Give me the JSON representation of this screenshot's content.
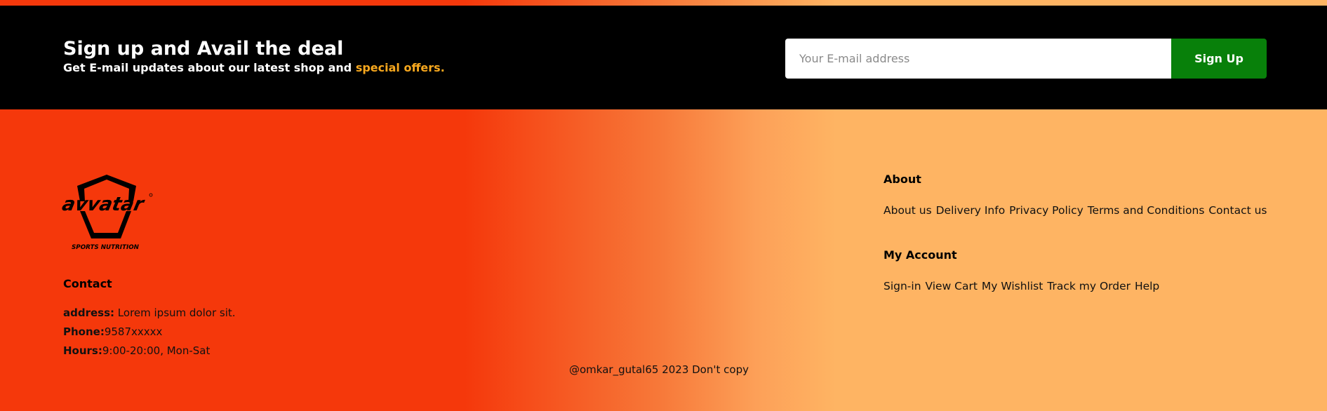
{
  "newsletter": {
    "title": "Sign up and Avail the deal",
    "subtitle_prefix": "Get E-mail updates about our latest shop and ",
    "subtitle_highlight": "special offers.",
    "email_placeholder": "Your E-mail address",
    "signup_label": "Sign Up"
  },
  "logo": {
    "brand": "avvatar",
    "tagline": "SPORTS NUTRITION"
  },
  "contact": {
    "title": "Contact",
    "address_label": "address:",
    "address_value": " Lorem ipsum dolor sit.",
    "phone_label": "Phone:",
    "phone_value": "9587xxxxx",
    "hours_label": "Hours:",
    "hours_value": "9:00-20:00, Mon-Sat"
  },
  "about": {
    "title": "About",
    "links": [
      "About us",
      "Delivery Info",
      "Privacy Policy",
      "Terms and Conditions",
      "Contact us"
    ]
  },
  "account": {
    "title": "My Account",
    "links": [
      "Sign-in",
      "View Cart",
      "My Wishlist",
      "Track my Order",
      "Help"
    ]
  },
  "copyright": "@omkar_gutal65 2023 Don't copy",
  "colors": {
    "accent": "#f8a81e",
    "signup_button": "#08800a",
    "gradient_left": "#f5380b",
    "gradient_right": "#feb463"
  }
}
